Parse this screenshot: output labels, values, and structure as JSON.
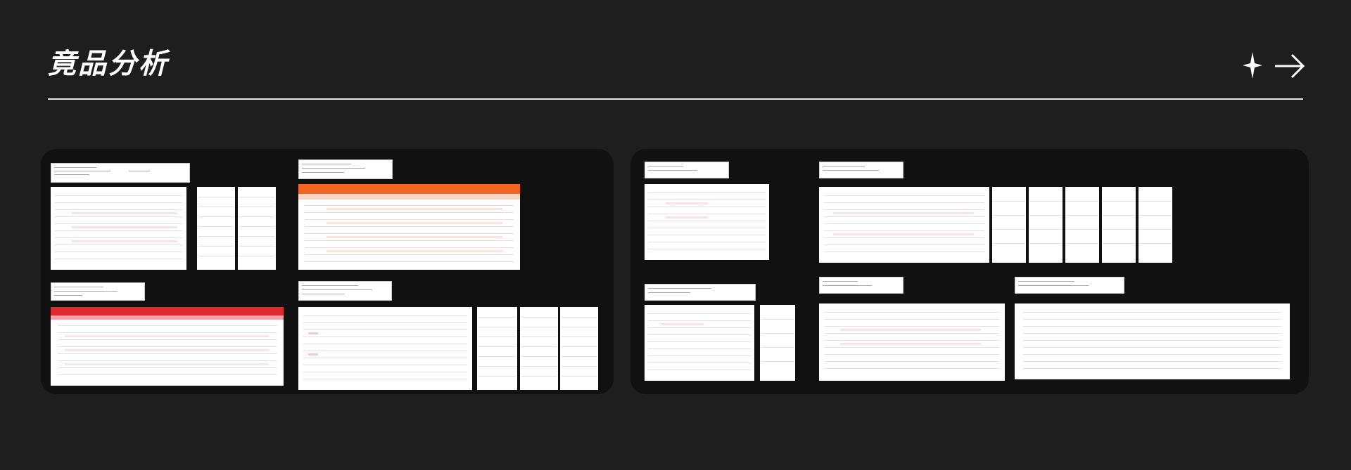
{
  "page": {
    "title": "竟品分析",
    "decor": {
      "sparkle": "sparkle-icon",
      "arrow": "right-arrow-icon"
    },
    "colors": {
      "background": "#1e1e1f",
      "panel": "#111112",
      "rule": "#e8e8e8",
      "accent_orange": "#f26522",
      "accent_red": "#e0282e"
    }
  },
  "left_panel": {
    "groups": [
      {
        "label": "",
        "header": "white"
      },
      {
        "label": "",
        "header": "orange"
      },
      {
        "label": "",
        "header": "red"
      },
      {
        "label": "",
        "header": "white"
      }
    ]
  },
  "right_panel": {
    "groups": [
      {
        "label": "",
        "header": "white"
      },
      {
        "label": "",
        "header": "white"
      },
      {
        "label": "",
        "header": "white"
      },
      {
        "label": "",
        "header": "white"
      },
      {
        "label": "",
        "header": "white"
      }
    ]
  }
}
